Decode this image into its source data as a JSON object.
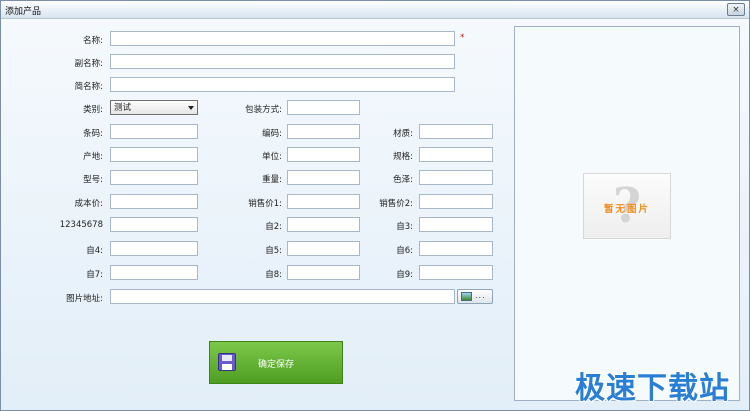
{
  "window": {
    "title": "添加产品",
    "close_label": "×"
  },
  "form": {
    "name": {
      "label": "名称:",
      "value": "",
      "required_mark": "*"
    },
    "subname": {
      "label": "副名称:",
      "value": ""
    },
    "shortname": {
      "label": "简名称:",
      "value": ""
    },
    "category": {
      "label": "类别:",
      "selected": "测试"
    },
    "packing": {
      "label": "包装方式:",
      "value": ""
    },
    "barcode": {
      "label": "条码:",
      "value": ""
    },
    "code": {
      "label": "编码:",
      "value": ""
    },
    "material": {
      "label": "材质:",
      "value": ""
    },
    "origin": {
      "label": "产地:",
      "value": ""
    },
    "unit": {
      "label": "单位:",
      "value": ""
    },
    "spec": {
      "label": "规格:",
      "value": ""
    },
    "model": {
      "label": "型号:",
      "value": ""
    },
    "weight": {
      "label": "重量:",
      "value": ""
    },
    "color": {
      "label": "色泽:",
      "value": ""
    },
    "cost": {
      "label": "成本价:",
      "value": ""
    },
    "price1": {
      "label": "销售价1:",
      "value": ""
    },
    "price2": {
      "label": "销售价2:",
      "value": ""
    },
    "c1": {
      "label": "12345678",
      "value": ""
    },
    "c2": {
      "label": "自2:",
      "value": ""
    },
    "c3": {
      "label": "自3:",
      "value": ""
    },
    "c4": {
      "label": "自4:",
      "value": ""
    },
    "c5": {
      "label": "自5:",
      "value": ""
    },
    "c6": {
      "label": "自6:",
      "value": ""
    },
    "c7": {
      "label": "自7:",
      "value": ""
    },
    "c8": {
      "label": "自8:",
      "value": ""
    },
    "c9": {
      "label": "自9:",
      "value": ""
    },
    "image_path": {
      "label": "图片地址:",
      "value": "",
      "browse_label": "..."
    }
  },
  "preview": {
    "placeholder_text": "暂无图片",
    "glyph": "?"
  },
  "actions": {
    "save_label": "确定保存"
  },
  "watermark": {
    "text": "极速下载站"
  },
  "icons": {
    "browse": "image-icon",
    "save": "floppy-disk-icon",
    "close": "close-icon"
  }
}
